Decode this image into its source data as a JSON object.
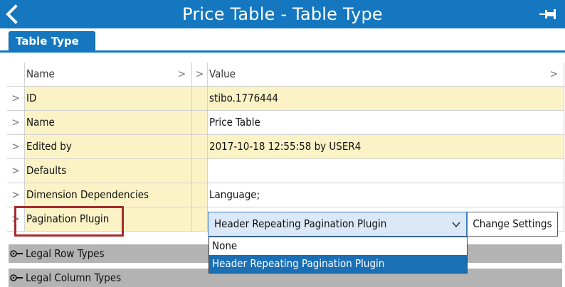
{
  "titlebar": {
    "title": "Price Table - Table Type"
  },
  "tabs": [
    {
      "label": "Table Type"
    }
  ],
  "grid": {
    "headers": {
      "name": "Name",
      "value": "Value"
    },
    "rows": [
      {
        "name": "ID",
        "value": "stibo.1776444"
      },
      {
        "name": "Name",
        "value": "Price Table"
      },
      {
        "name": "Edited by",
        "value": "2017-10-18 12:55:58 by USER4"
      },
      {
        "name": "Defaults",
        "value": ""
      },
      {
        "name": "Dimension Dependencies",
        "value": "Language;"
      },
      {
        "name": "Pagination Plugin",
        "value": "Header Repeating Pagination Plugin"
      }
    ]
  },
  "pagination": {
    "selected": "Header Repeating Pagination Plugin",
    "change_label": "Change Settings",
    "options": [
      "None",
      "Header Repeating Pagination Plugin"
    ]
  },
  "sections": [
    {
      "label": "Legal Row Types"
    },
    {
      "label": "Legal Column Types"
    }
  ],
  "colors": {
    "accent": "#1477c0",
    "row_yellow": "#fbf3c6",
    "highlight": "#a72a2d",
    "section_gray": "#b3b3b3"
  },
  "icons": {
    "back": "back-arrow-icon",
    "pin": "pin-icon",
    "expand": "chevron-right-icon",
    "section": "expand-key-icon"
  }
}
